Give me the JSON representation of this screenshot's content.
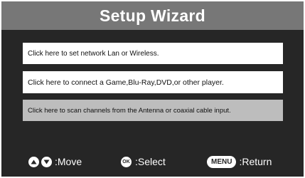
{
  "window": {
    "title": "Setup Wizard"
  },
  "menu": {
    "items": [
      {
        "label": "Click here to set network Lan or Wireless.",
        "selected": false
      },
      {
        "label": "Click here to connect a Game,Blu-Ray,DVD,or other player.",
        "selected": false
      },
      {
        "label": "Click here to scan channels from the Antenna or coaxial cable input.",
        "selected": true
      }
    ]
  },
  "footer": {
    "move_label": ":Move",
    "select_key": "OK",
    "select_label": ":Select",
    "menu_key": "MENU",
    "return_label": ":Return",
    "icons": [
      "up-arrow-icon",
      "down-arrow-icon",
      "ok-key-icon",
      "menu-key-icon"
    ]
  },
  "colors": {
    "background": "#262626",
    "title_bar": "#777777",
    "item_normal": "#ffffff",
    "item_selected": "#bdbdbd"
  }
}
